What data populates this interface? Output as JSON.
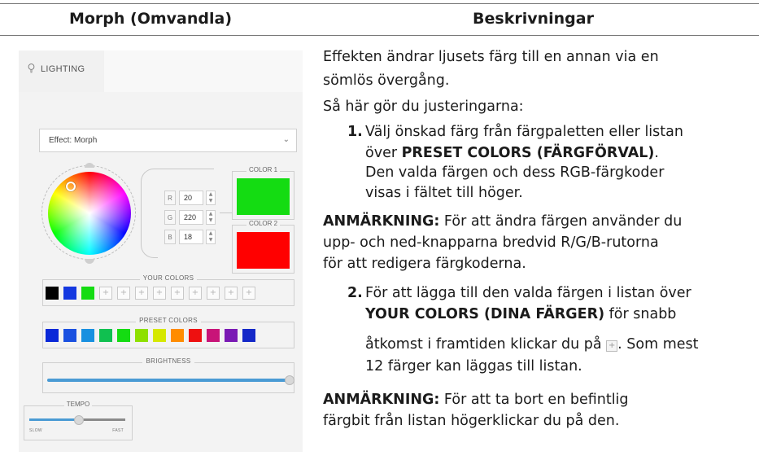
{
  "table": {
    "header_left": "Morph (Omvandla)",
    "header_right": "Beskrivningar"
  },
  "app": {
    "tab_label": "LIGHTING",
    "effect_dropdown": "Effect: Morph",
    "rgb": {
      "r_label": "R",
      "r_value": "20",
      "g_label": "G",
      "g_value": "220",
      "b_label": "B",
      "b_value": "18"
    },
    "color1_label": "COLOR 1",
    "color1_hex": "#14dc12",
    "color2_label": "COLOR 2",
    "color2_hex": "#ff0000",
    "your_colors_label": "YOUR COLORS",
    "your_colors": [
      "#000000",
      "#1438e0",
      "#14dc12"
    ],
    "your_colors_empty_slots": 9,
    "preset_colors_label": "PRESET COLORS",
    "preset_colors": [
      "#0a28d8",
      "#1a50e0",
      "#1890e0",
      "#10c050",
      "#14dc12",
      "#8ee000",
      "#d6e800",
      "#ff8c00",
      "#ee1010",
      "#c81478",
      "#7a1ab4",
      "#1428c8"
    ],
    "brightness_label": "BRIGHTNESS",
    "brightness_level": 1.0,
    "tempo_label": "TEMPO",
    "tempo_slow": "SLOW",
    "tempo_fast": "FAST",
    "tempo_level": 0.5
  },
  "desc": {
    "intro1": "Effekten ändrar ljusets färg till en annan via en",
    "intro2": "sömlös övergång.",
    "howto": "Så här gör du justeringarna:",
    "step1_num": "1.",
    "step1_l1": "Välj önskad färg från färgpaletten eller listan",
    "step1_l2a": "över ",
    "step1_l2b": "PRESET COLORS (FÄRGFÖRVAL)",
    "step1_l2c": ".",
    "step1_l3": "Den valda färgen och dess RGB-färgkoder",
    "step1_l4": "visas i fältet till höger.",
    "note1_label": "ANMÄRKNING:",
    "note1_l1": " För att ändra färgen använder du",
    "note1_l2": "upp- och ned-knapparna bredvid R/G/B-rutorna",
    "note1_l3": "för att redigera färgkoderna.",
    "step2_num": "2.",
    "step2_l1": "För att lägga till den valda färgen i listan över",
    "step2_l2a": "YOUR COLORS (DINA FÄRGER)",
    "step2_l2b": " för snabb",
    "step2_l3a": "åtkomst i framtiden klickar du på ",
    "step2_l3b": ". Som mest",
    "step2_l4": "12 färger kan läggas till listan.",
    "note2_label": "ANMÄRKNING:",
    "note2_l1": " För att ta bort en befintlig",
    "note2_l2": "färgbit från listan högerklickar du på den."
  }
}
